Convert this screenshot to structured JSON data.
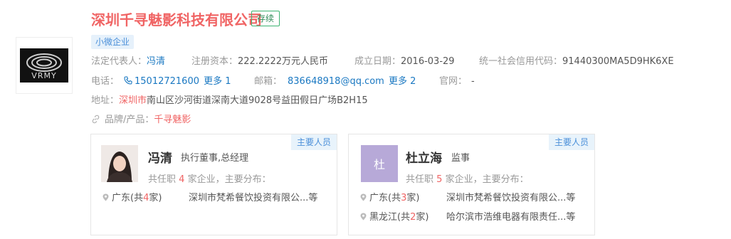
{
  "company": {
    "name": "深圳千寻魅影科技有限公司",
    "status": "存续",
    "tag": "小微企业",
    "logo_text": "VRMY"
  },
  "info": {
    "legal_rep_label": "法定代表人：",
    "legal_rep_value": "冯清",
    "capital_label": "注册资本：",
    "capital_value": "222.2222万元人民币",
    "founded_label": "成立日期：",
    "founded_value": "2016-03-29",
    "credit_label": "统一社会信用代码：",
    "credit_value": "91440300MA5D9HK6XE",
    "phone_label": "电话：",
    "phone_value": "15012721600",
    "phone_more": "更多 1",
    "email_label": "邮箱：",
    "email_value": "836648918@qq.com",
    "email_more": "更多 2",
    "website_label": "官网：",
    "website_value": "-",
    "address_label": "地址：",
    "address_city": "深圳市",
    "address_rest": "南山区沙河街道深南大道9028号益田假日广场B2H15",
    "brand_label": "品牌/产品：",
    "brand_value": "千寻魅影"
  },
  "people": [
    {
      "tag": "主要人员",
      "name": "冯清",
      "role": "执行董事,总经理",
      "count_prefix": "共任职",
      "count": "4",
      "count_suffix": "家企业，主要分布：",
      "regions": [
        {
          "prefix": "广东(共",
          "num": "4",
          "suffix": "家)",
          "company": "深圳市梵希餐饮投资有限公...",
          "more": "等"
        }
      ]
    },
    {
      "tag": "主要人员",
      "name": "杜立海",
      "role": "监事",
      "avatar_letter": "杜",
      "count_prefix": "共任职",
      "count": "5",
      "count_suffix": "家企业，主要分布：",
      "regions": [
        {
          "prefix": "广东(共",
          "num": "3",
          "suffix": "家)",
          "company": "深圳市梵希餐饮投资有限公...",
          "more": "等"
        },
        {
          "prefix": "黑龙江(共",
          "num": "2",
          "suffix": "家)",
          "company": "哈尔滨市浩维电器有限责任...",
          "more": "等"
        }
      ]
    }
  ],
  "colors": {
    "accent_red": "#f06464",
    "link_blue": "#1a78c2",
    "status_green": "#3cb371"
  }
}
